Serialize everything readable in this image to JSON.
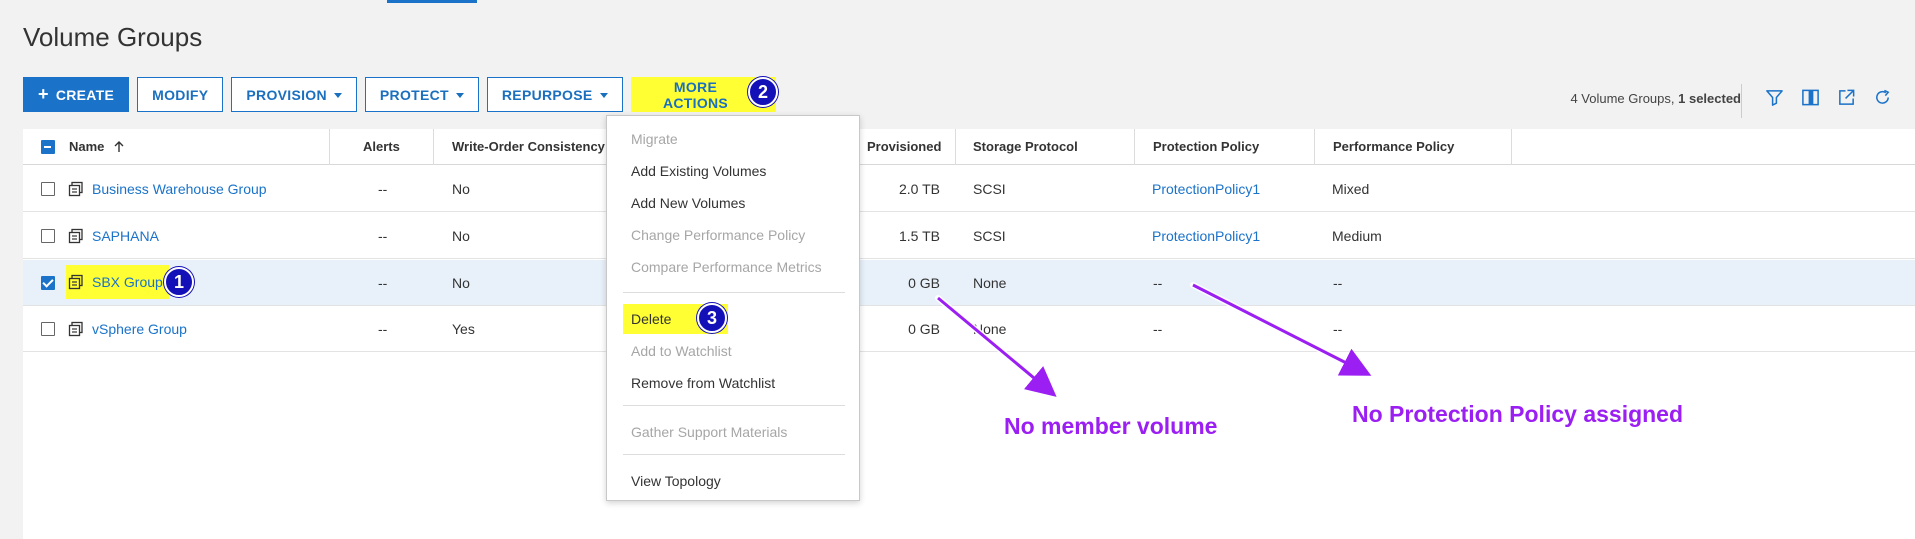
{
  "page": {
    "title": "Volume Groups"
  },
  "toolbar": {
    "create": "CREATE",
    "modify": "MODIFY",
    "provision": "PROVISION",
    "protect": "PROTECT",
    "repurpose": "REPURPOSE",
    "more_actions": "MORE ACTIONS"
  },
  "summary": {
    "count_text": "4 Volume Groups,",
    "selected_text": "1 selected"
  },
  "table": {
    "columns": {
      "name": "Name",
      "alerts": "Alerts",
      "write_order": "Write-Order Consistency",
      "provisioned": "Provisioned",
      "storage_protocol": "Storage Protocol",
      "protection_policy": "Protection Policy",
      "performance_policy": "Performance Policy"
    },
    "rows": [
      {
        "name": "Business Warehouse Group",
        "alerts": "--",
        "write_order": "No",
        "provisioned": "2.0 TB",
        "protocol": "SCSI",
        "protection": "ProtectionPolicy1",
        "performance": "Mixed",
        "checked": false
      },
      {
        "name": "SAPHANA",
        "alerts": "--",
        "write_order": "No",
        "provisioned": "1.5 TB",
        "protocol": "SCSI",
        "protection": "ProtectionPolicy1",
        "performance": "Medium",
        "checked": false
      },
      {
        "name": "SBX Group",
        "alerts": "--",
        "write_order": "No",
        "provisioned": "0 GB",
        "protocol": "None",
        "protection": "--",
        "performance": "--",
        "checked": true
      },
      {
        "name": "vSphere Group",
        "alerts": "--",
        "write_order": "Yes",
        "provisioned": "0 GB",
        "protocol": "None",
        "protection": "--",
        "performance": "--",
        "checked": false
      }
    ]
  },
  "menu": {
    "migrate": "Migrate",
    "add_existing": "Add Existing Volumes",
    "add_new": "Add New Volumes",
    "change_perf": "Change Performance Policy",
    "compare_perf": "Compare Performance Metrics",
    "delete": "Delete",
    "add_watchlist": "Add to Watchlist",
    "remove_watchlist": "Remove from Watchlist",
    "gather_support": "Gather Support Materials",
    "view_topology": "View Topology"
  },
  "badges": {
    "one": "1",
    "two": "2",
    "three": "3"
  },
  "annotations": {
    "no_member": "No member volume",
    "no_protection": "No Protection Policy assigned"
  },
  "colors": {
    "accent": "#1a73c9",
    "highlight": "#ffff33",
    "badge": "#1410b8",
    "annotation": "#9b1ff2"
  }
}
